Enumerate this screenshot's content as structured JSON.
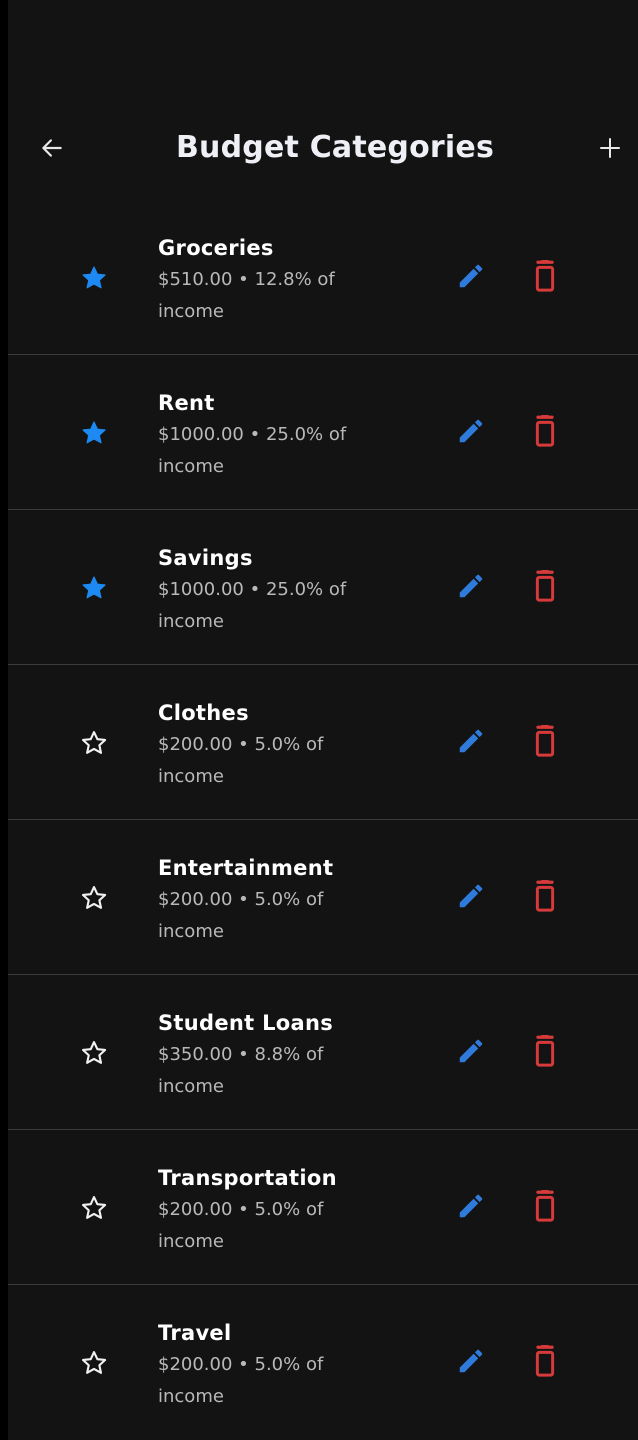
{
  "header": {
    "title": "Budget Categories",
    "back_icon": "arrow-left-icon",
    "add_icon": "plus-icon"
  },
  "colors": {
    "background": "#131313",
    "accent_blue": "#2f7bdc",
    "star_blue": "#1d89f2",
    "delete_red": "#d63a3a",
    "divider": "#3a3a3a"
  },
  "categories": [
    {
      "name": "Groceries",
      "detail": "$510.00 • 12.8% of income",
      "favorite": true
    },
    {
      "name": "Rent",
      "detail": "$1000.00 • 25.0% of income",
      "favorite": true
    },
    {
      "name": "Savings",
      "detail": "$1000.00 • 25.0% of income",
      "favorite": true
    },
    {
      "name": "Clothes",
      "detail": "$200.00 • 5.0% of income",
      "favorite": false
    },
    {
      "name": "Entertainment",
      "detail": "$200.00 • 5.0% of income",
      "favorite": false
    },
    {
      "name": "Student Loans",
      "detail": "$350.00 • 8.8% of income",
      "favorite": false
    },
    {
      "name": "Transportation",
      "detail": "$200.00 • 5.0% of income",
      "favorite": false
    },
    {
      "name": "Travel",
      "detail": "$200.00 • 5.0% of income",
      "favorite": false
    }
  ]
}
